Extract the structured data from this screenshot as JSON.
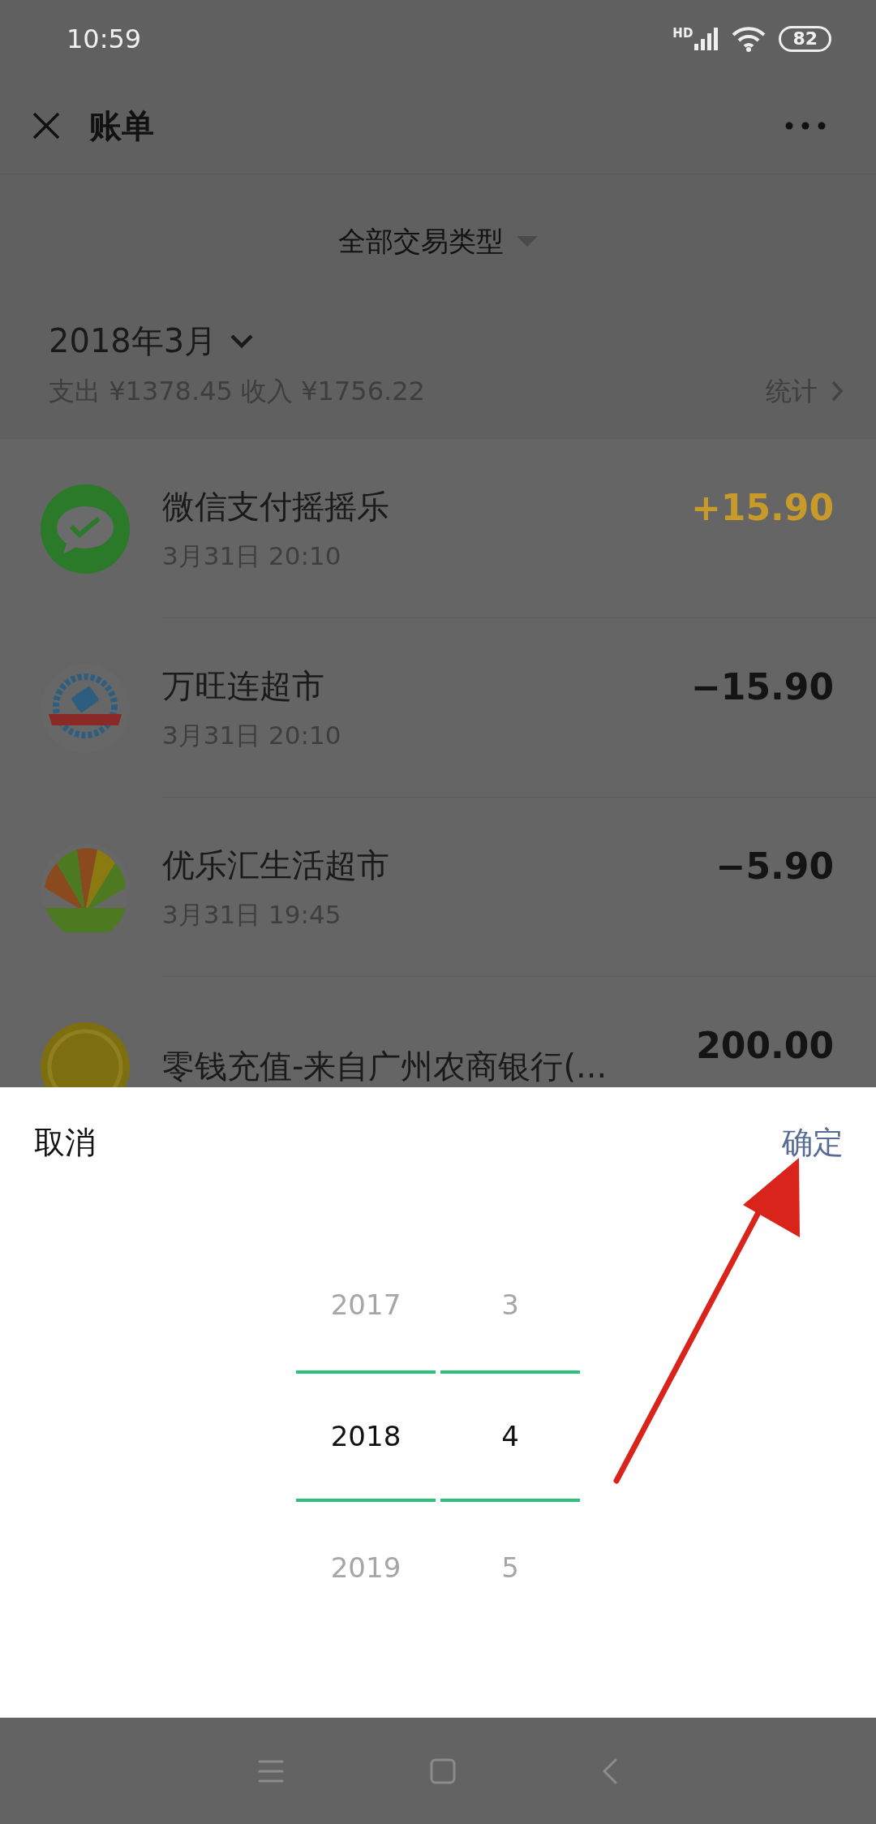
{
  "status_bar": {
    "time": "10:59",
    "network": "HD",
    "battery": "82"
  },
  "header": {
    "title": "账单"
  },
  "filter": {
    "label": "全部交易类型"
  },
  "month": {
    "label": "2018年3月",
    "summary": "支出 ¥1378.45 收入 ¥1756.22",
    "stats": "统计"
  },
  "transactions": [
    {
      "title": "微信支付摇摇乐",
      "time": "3月31日 20:10",
      "amount": "+15.90",
      "kind": "income"
    },
    {
      "title": "万旺连超市",
      "time": "3月31日 20:10",
      "amount": "−15.90",
      "kind": "expense"
    },
    {
      "title": "优乐汇生活超市",
      "time": "3月31日 19:45",
      "amount": "−5.90",
      "kind": "expense"
    },
    {
      "title": "零钱充值-来自广州农商银行(...",
      "amount": "200.00",
      "kind": "plain"
    }
  ],
  "picker": {
    "cancel": "取消",
    "confirm": "确定",
    "years": [
      {
        "label": "2017",
        "selected": false
      },
      {
        "label": "2018",
        "selected": true
      },
      {
        "label": "2019",
        "selected": false
      }
    ],
    "months": [
      {
        "label": "3",
        "selected": false
      },
      {
        "label": "4",
        "selected": true
      },
      {
        "label": "5",
        "selected": false
      }
    ]
  }
}
